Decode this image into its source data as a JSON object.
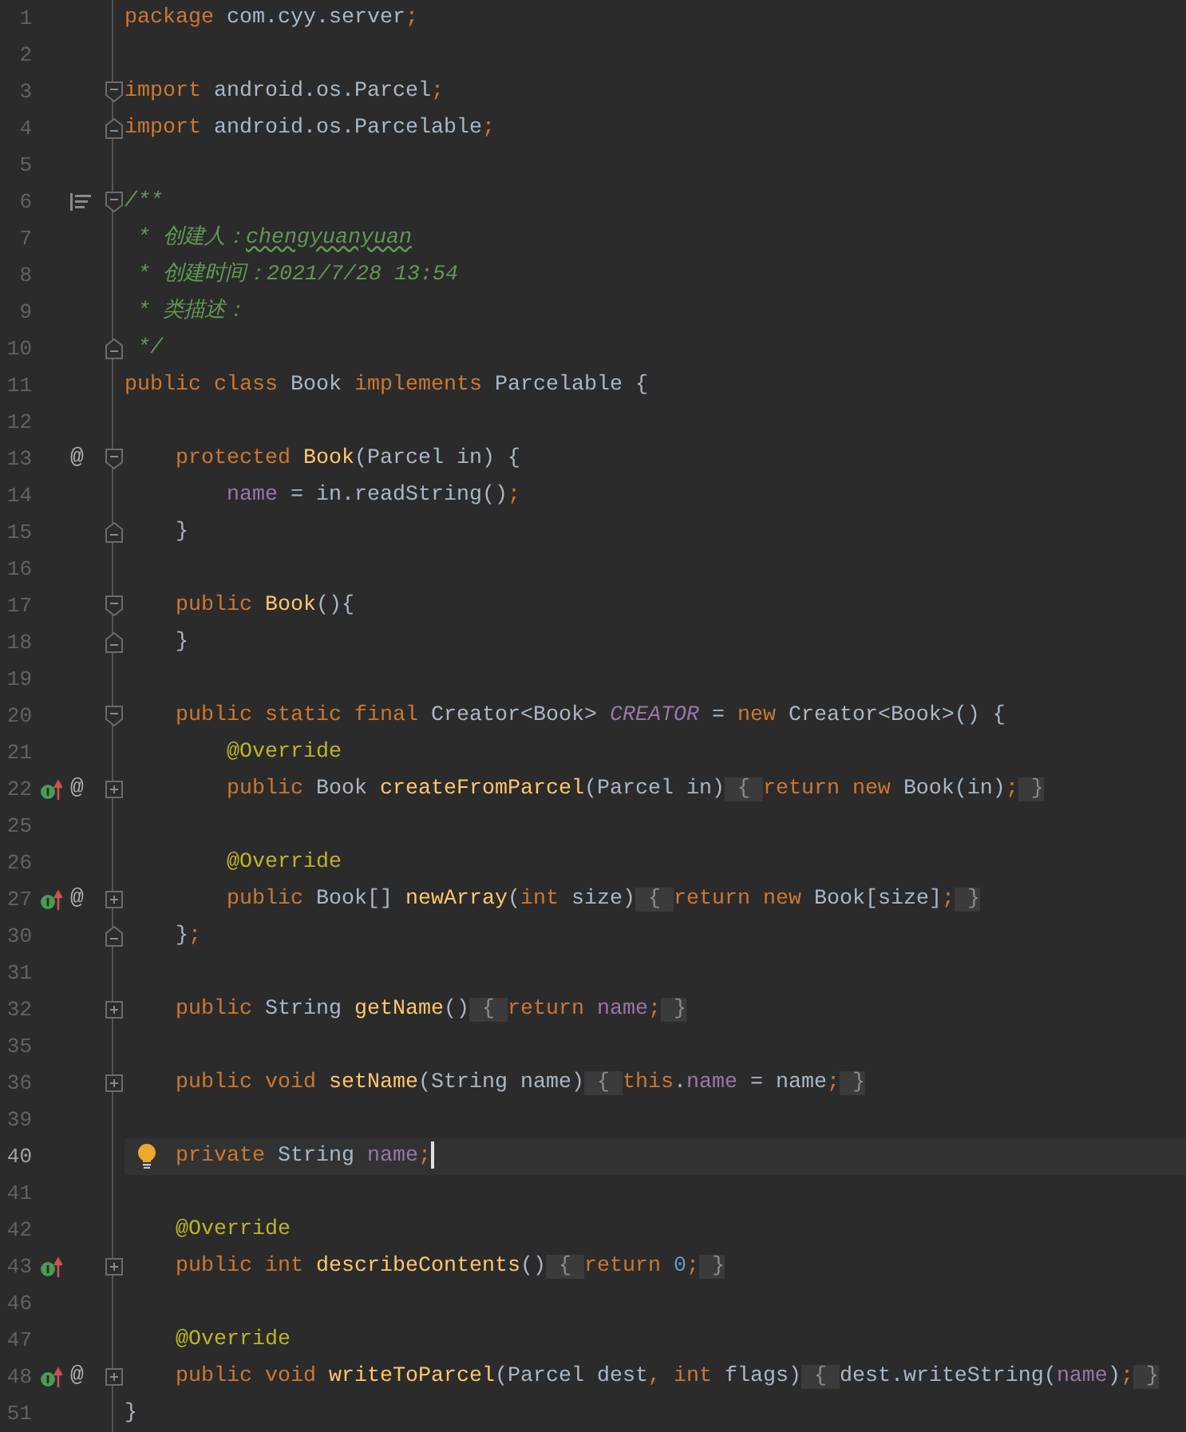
{
  "lines": [
    {
      "number": "1",
      "current": false,
      "tokens": [
        {
          "kind": "kw",
          "text": "package "
        },
        {
          "kind": "plain",
          "text": "com.cyy.server"
        },
        {
          "kind": "kw",
          "text": ";"
        }
      ]
    },
    {
      "number": "2",
      "current": false
    },
    {
      "number": "3",
      "current": false,
      "fold": {
        "kind": "open"
      },
      "tokens": [
        {
          "kind": "kw",
          "text": "import "
        },
        {
          "kind": "plain",
          "text": "android.os.Parcel"
        },
        {
          "kind": "kw",
          "text": ";"
        }
      ]
    },
    {
      "number": "4",
      "current": false,
      "fold": {
        "kind": "close"
      },
      "tokens": [
        {
          "kind": "kw",
          "text": "import "
        },
        {
          "kind": "plain",
          "text": "android.os.Parcelable"
        },
        {
          "kind": "kw",
          "text": ";"
        }
      ]
    },
    {
      "number": "5",
      "current": false
    },
    {
      "number": "6",
      "current": false,
      "fold": {
        "kind": "open"
      },
      "gutter": [
        {
          "kind": "params"
        }
      ],
      "tokens": [
        {
          "kind": "doc",
          "text": "/**"
        }
      ]
    },
    {
      "number": "7",
      "current": false,
      "tokens": [
        {
          "kind": "doc",
          "text": " * 创建人："
        },
        {
          "kind": "typo",
          "text": "chengyuanyuan"
        }
      ]
    },
    {
      "number": "8",
      "current": false,
      "tokens": [
        {
          "kind": "doc",
          "text": " * 创建时间：2021/7/28 13:54"
        }
      ]
    },
    {
      "number": "9",
      "current": false,
      "tokens": [
        {
          "kind": "doc",
          "text": " * 类描述："
        }
      ]
    },
    {
      "number": "10",
      "current": false,
      "fold": {
        "kind": "close"
      },
      "tokens": [
        {
          "kind": "doc",
          "text": " */"
        }
      ]
    },
    {
      "number": "11",
      "current": false,
      "tokens": [
        {
          "kind": "kw",
          "text": "public class "
        },
        {
          "kind": "plain",
          "text": "Book "
        },
        {
          "kind": "kw",
          "text": "implements "
        },
        {
          "kind": "plain",
          "text": "Parcelable {"
        }
      ]
    },
    {
      "number": "12",
      "current": false
    },
    {
      "number": "13",
      "current": false,
      "fold": {
        "kind": "open"
      },
      "gutter": [
        {
          "kind": "at",
          "text": "@"
        }
      ],
      "tokens": [
        {
          "kind": "kw",
          "text": "    protected "
        },
        {
          "kind": "method",
          "text": "Book"
        },
        {
          "kind": "plain",
          "text": "(Parcel in) {"
        }
      ]
    },
    {
      "number": "14",
      "current": false,
      "tokens": [
        {
          "kind": "field",
          "text": "        name"
        },
        {
          "kind": "plain",
          "text": " = in.readString()"
        },
        {
          "kind": "kw",
          "text": ";"
        }
      ]
    },
    {
      "number": "15",
      "current": false,
      "fold": {
        "kind": "close"
      },
      "tokens": [
        {
          "kind": "plain",
          "text": "    }"
        }
      ]
    },
    {
      "number": "16",
      "current": false
    },
    {
      "number": "17",
      "current": false,
      "fold": {
        "kind": "open"
      },
      "tokens": [
        {
          "kind": "kw",
          "text": "    public "
        },
        {
          "kind": "method",
          "text": "Book"
        },
        {
          "kind": "plain",
          "text": "(){"
        }
      ]
    },
    {
      "number": "18",
      "current": false,
      "fold": {
        "kind": "close"
      },
      "tokens": [
        {
          "kind": "plain",
          "text": "    }"
        }
      ]
    },
    {
      "number": "19",
      "current": false
    },
    {
      "number": "20",
      "current": false,
      "fold": {
        "kind": "open"
      },
      "tokens": [
        {
          "kind": "kw",
          "text": "    public static final "
        },
        {
          "kind": "plain",
          "text": "Creator<Book> "
        },
        {
          "kind": "static",
          "text": "CREATOR"
        },
        {
          "kind": "plain",
          "text": " = "
        },
        {
          "kind": "kw",
          "text": "new "
        },
        {
          "kind": "plain",
          "text": "Creator<Book>() {"
        }
      ]
    },
    {
      "number": "21",
      "current": false,
      "tokens": [
        {
          "kind": "anno",
          "text": "        @Override"
        }
      ]
    },
    {
      "number": "22",
      "current": false,
      "fold": {
        "kind": "collapsed"
      },
      "gutter": [
        {
          "kind": "implements"
        },
        {
          "kind": "at",
          "text": "@"
        }
      ],
      "tokens": [
        {
          "kind": "kw",
          "text": "        public "
        },
        {
          "kind": "plain",
          "text": "Book "
        },
        {
          "kind": "method",
          "text": "createFromParcel"
        },
        {
          "kind": "plain",
          "text": "(Parcel in)"
        },
        {
          "kind": "folded",
          "text": " { "
        },
        {
          "kind": "kw",
          "text": "return new "
        },
        {
          "kind": "plain",
          "text": "Book(in)"
        },
        {
          "kind": "kw",
          "text": ";"
        },
        {
          "kind": "folded",
          "text": " }"
        }
      ]
    },
    {
      "number": "25",
      "current": false
    },
    {
      "number": "26",
      "current": false,
      "tokens": [
        {
          "kind": "anno",
          "text": "        @Override"
        }
      ]
    },
    {
      "number": "27",
      "current": false,
      "fold": {
        "kind": "collapsed"
      },
      "gutter": [
        {
          "kind": "implements"
        },
        {
          "kind": "at",
          "text": "@"
        }
      ],
      "tokens": [
        {
          "kind": "kw",
          "text": "        public "
        },
        {
          "kind": "plain",
          "text": "Book[] "
        },
        {
          "kind": "method",
          "text": "newArray"
        },
        {
          "kind": "plain",
          "text": "("
        },
        {
          "kind": "kw",
          "text": "int "
        },
        {
          "kind": "plain",
          "text": "size)"
        },
        {
          "kind": "folded",
          "text": " { "
        },
        {
          "kind": "kw",
          "text": "return new "
        },
        {
          "kind": "plain",
          "text": "Book[size]"
        },
        {
          "kind": "kw",
          "text": ";"
        },
        {
          "kind": "folded",
          "text": " }"
        }
      ]
    },
    {
      "number": "30",
      "current": false,
      "fold": {
        "kind": "close"
      },
      "tokens": [
        {
          "kind": "plain",
          "text": "    }"
        },
        {
          "kind": "kw",
          "text": ";"
        }
      ]
    },
    {
      "number": "31",
      "current": false
    },
    {
      "number": "32",
      "current": false,
      "fold": {
        "kind": "collapsed"
      },
      "tokens": [
        {
          "kind": "kw",
          "text": "    public "
        },
        {
          "kind": "plain",
          "text": "String "
        },
        {
          "kind": "method",
          "text": "getName"
        },
        {
          "kind": "plain",
          "text": "()"
        },
        {
          "kind": "folded",
          "text": " { "
        },
        {
          "kind": "kw",
          "text": "return "
        },
        {
          "kind": "field",
          "text": "name"
        },
        {
          "kind": "kw",
          "text": ";"
        },
        {
          "kind": "folded",
          "text": " }"
        }
      ]
    },
    {
      "number": "35",
      "current": false
    },
    {
      "number": "36",
      "current": false,
      "fold": {
        "kind": "collapsed"
      },
      "tokens": [
        {
          "kind": "kw",
          "text": "    public void "
        },
        {
          "kind": "method",
          "text": "setName"
        },
        {
          "kind": "plain",
          "text": "(String name)"
        },
        {
          "kind": "folded",
          "text": " { "
        },
        {
          "kind": "kw",
          "text": "this"
        },
        {
          "kind": "plain",
          "text": "."
        },
        {
          "kind": "field",
          "text": "name"
        },
        {
          "kind": "plain",
          "text": " = name"
        },
        {
          "kind": "kw",
          "text": ";"
        },
        {
          "kind": "folded",
          "text": " }"
        }
      ]
    },
    {
      "number": "39",
      "current": false
    },
    {
      "number": "40",
      "current": true,
      "gutter": [
        {
          "kind": "bulb"
        }
      ],
      "tokens": [
        {
          "kind": "kw",
          "text": "    private "
        },
        {
          "kind": "plain",
          "text": "String "
        },
        {
          "kind": "field",
          "text": "name"
        },
        {
          "kind": "kw",
          "text": ";"
        }
      ]
    },
    {
      "number": "41",
      "current": false
    },
    {
      "number": "42",
      "current": false,
      "tokens": [
        {
          "kind": "anno",
          "text": "    @Override"
        }
      ]
    },
    {
      "number": "43",
      "current": false,
      "fold": {
        "kind": "collapsed"
      },
      "gutter": [
        {
          "kind": "implements"
        }
      ],
      "tokens": [
        {
          "kind": "kw",
          "text": "    public int "
        },
        {
          "kind": "method",
          "text": "describeContents"
        },
        {
          "kind": "plain",
          "text": "()"
        },
        {
          "kind": "folded",
          "text": " { "
        },
        {
          "kind": "kw",
          "text": "return "
        },
        {
          "kind": "num",
          "text": "0"
        },
        {
          "kind": "kw",
          "text": ";"
        },
        {
          "kind": "folded",
          "text": " }"
        }
      ]
    },
    {
      "number": "46",
      "current": false
    },
    {
      "number": "47",
      "current": false,
      "tokens": [
        {
          "kind": "anno",
          "text": "    @Override"
        }
      ]
    },
    {
      "number": "48",
      "current": false,
      "fold": {
        "kind": "collapsed"
      },
      "gutter": [
        {
          "kind": "implements"
        },
        {
          "kind": "at",
          "text": "@"
        }
      ],
      "tokens": [
        {
          "kind": "kw",
          "text": "    public void "
        },
        {
          "kind": "method",
          "text": "writeToParcel"
        },
        {
          "kind": "plain",
          "text": "(Parcel dest"
        },
        {
          "kind": "kw",
          "text": ", int "
        },
        {
          "kind": "plain",
          "text": "flags)"
        },
        {
          "kind": "folded",
          "text": " { "
        },
        {
          "kind": "plain",
          "text": "dest.writeString("
        },
        {
          "kind": "field",
          "text": "name"
        },
        {
          "kind": "plain",
          "text": ")"
        },
        {
          "kind": "kw",
          "text": ";"
        },
        {
          "kind": "folded",
          "text": " }"
        }
      ]
    },
    {
      "number": "51",
      "current": false,
      "tokens": [
        {
          "kind": "plain",
          "text": "}"
        }
      ]
    }
  ]
}
